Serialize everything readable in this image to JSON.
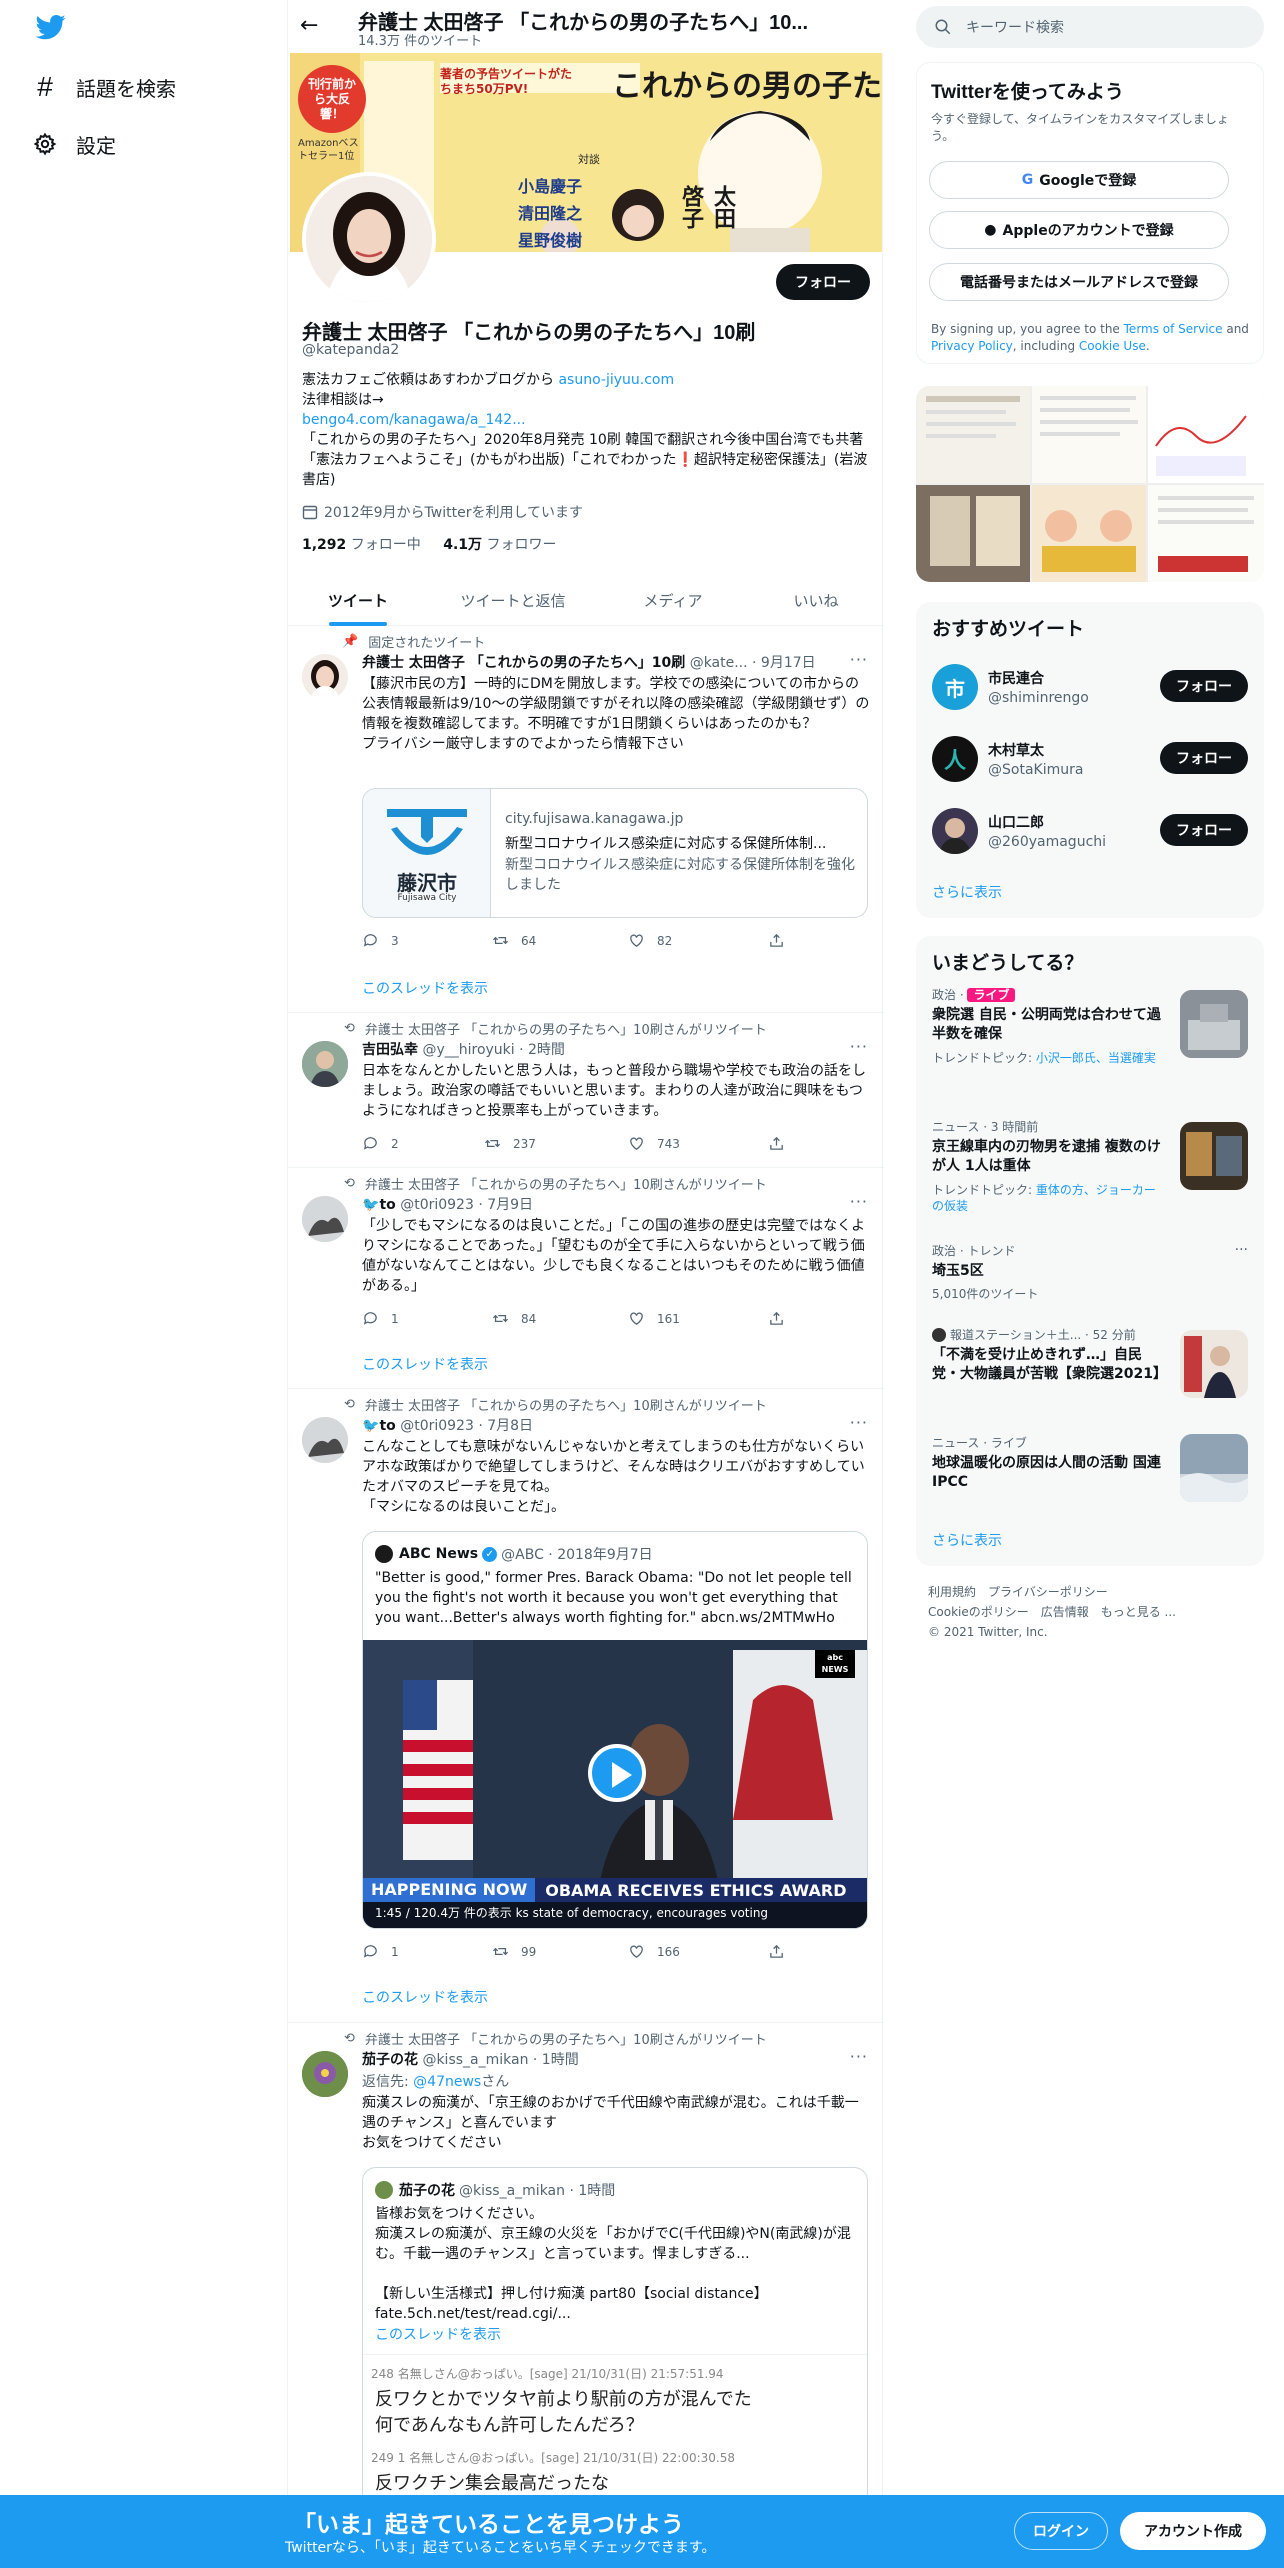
{
  "nav": {
    "search_label": "話題を検索",
    "settings_label": "設定"
  },
  "header": {
    "title": "弁護士 太田啓子 「これからの男の子たちへ」10...",
    "tweet_count": "14.3万 件のツイート"
  },
  "banner": {
    "top_label": "刊行前から大反響！",
    "top_sub": "Amazonベストセラー1位",
    "pv_label": "著者の予告ツイートがたちまち50万PV!",
    "big_title": "これからの男の子たちへ",
    "author": "太田啓子",
    "guests": [
      "小島慶子",
      "清田隆之",
      "星野俊樹"
    ],
    "taidan": "対談"
  },
  "profile": {
    "follow_label": "フォロー",
    "name": "弁護士 太田啓子 「これからの男の子たちへ」10刷",
    "handle": "@katepanda2",
    "bio_line1": "憲法カフェご依頼はあすわかブログから ",
    "bio_link1": "asuno-jiyuu.com",
    "bio_line2": "法律相談は→",
    "bio_link2": "bengo4.com/kanagawa/a_142...",
    "bio_line3": "「これからの男の子たちへ」2020年8月発売 10刷 韓国で翻訳され今後中国台湾でも共著「憲法カフェへようこそ」(かもがわ出版)「これでわかった❗超訳特定秘密保護法」(岩波書店)",
    "joined": "2012年9月からTwitterを利用しています",
    "following_count": "1,292",
    "following_label": " フォロー中",
    "followers_count": "4.1万",
    "followers_label": " フォロワー"
  },
  "tabs": [
    "ツイート",
    "ツイートと返信",
    "メディア",
    "いいね"
  ],
  "tweets": {
    "t1": {
      "pinned": "固定されたツイート",
      "name": "弁護士 太田啓子 「これからの男の子たちへ」10刷",
      "handle": "@kate... · 9月17日",
      "text": "【藤沢市民の方】一時的にDMを開放します。学校での感染についての市からの公表情報最新は9/10～の学級閉鎖ですがそれ以降の感染確認（学級閉鎖せず）の情報を複数確認してます。不明確ですが1日閉鎖くらいはあったのかも？\nプライバシー厳守しますのでよかったら情報下さい",
      "card_domain": "city.fujisawa.kanagawa.jp",
      "card_title": "新型コロナウイルス感染症に対応する保健所体制...",
      "card_desc": "新型コロナウイルス感染症に対応する保健所体制を強化しました",
      "card_city": "藤沢市",
      "card_city_en": "Fujisawa City",
      "replies": "3",
      "retweets": "64",
      "likes": "82",
      "thread": "このスレッドを表示"
    },
    "t2": {
      "rt": "弁護士 太田啓子 「これからの男の子たちへ」10刷さんがリツイート",
      "name": "吉田弘幸",
      "handle": "@y__hiroyuki · 2時間",
      "text": "日本をなんとかしたいと思う人は，もっと普段から職場や学校でも政治の話をしましょう。政治家の噂話でもいいと思います。まわりの人達が政治に興味をもつようになればきっと投票率も上がっていきます。",
      "replies": "2",
      "retweets": "237",
      "likes": "743"
    },
    "t3": {
      "rt": "弁護士 太田啓子 「これからの男の子たちへ」10刷さんがリツイート",
      "name": "to",
      "handle": "@t0ri0923 · 7月9日",
      "text": "「少しでもマシになるのは良いことだ。」「この国の進歩の歴史は完璧ではなくよりマシになることであった。」「望むものが全て手に入らないからといって戦う価値がないなんてことはない。少しでも良くなることはいつもそのために戦う価値がある。」",
      "replies": "1",
      "retweets": "84",
      "likes": "161",
      "thread": "このスレッドを表示"
    },
    "t4": {
      "rt": "弁護士 太田啓子 「これからの男の子たちへ」10刷さんがリツイート",
      "name": "to",
      "handle": "@t0ri0923 · 7月8日",
      "text": "こんなことしても意味がないんじゃないかと考えてしまうのも仕方がないくらいアホな政策ばかりで絶望してしまうけど、そんな時はクリエバがおすすめしていたオバマのスピーチを見てね。\n「マシになるのは良いことだ」。",
      "q_name": "ABC News",
      "q_handle": "@ABC · 2018年9月7日",
      "q_text": "\"Better is good,\" former Pres. Barack Obama: \"Do not let people tell you the fight's not worth it because you won't get everything that you want...Better's always worth fighting for.\" abcn.ws/2MTMwHo",
      "v_banner": "HAPPENING NOW",
      "v_title": "OBAMA RECEIVES ETHICS AWARD",
      "v_sub": "1:45 / 120.4万 件の表示 ks state of democracy, encourages voting",
      "v_logo": "abc NEWS",
      "replies": "1",
      "retweets": "99",
      "likes": "166",
      "thread": "このスレッドを表示"
    },
    "t5": {
      "rt": "弁護士 太田啓子 「これからの男の子たちへ」10刷さんがリツイート",
      "name": "茄子の花",
      "handle": "@kiss_a_mikan · 1時間",
      "reply_to_prefix": "返信先: ",
      "reply_to": "@47news",
      "reply_to_suffix": "さん",
      "text": "痴漢スレの痴漢が、「京王線のおかげで千代田線や南武線が混む。これは千載一遇のチャンス」と喜んでいます\nお気をつけてください",
      "q_name": "茄子の花",
      "q_handle": "@kiss_a_mikan · 1時間",
      "q_text": "皆様お気をつけください。\n痴漢スレの痴漢が、京王線の火災を「おかげでC(千代田線)やN(南武線)が混む。千載一遇のチャンス」と言っています。悍ましすぎる...\n\n【新しい生活様式】押し付け痴漢 part80【social distance】\nfate.5ch.net/test/read.cgi/...",
      "q_thread": "このスレッドを表示",
      "post1_head": "248  名無しさん@おっぱい。[sage] 21/10/31(日) 21:57:51.94",
      "post1_text": "反ワクとかでツタヤ前より駅前の方が混んでた\n何であんなもん許可したんだろ？",
      "post2_head": "249  1  名無しさん@おっぱい。[sage] 21/10/31(日) 22:00:30.58",
      "post2_text": "反ワクチン集会最高だったな"
    }
  },
  "right": {
    "search_placeholder": "キーワード検索",
    "signup": {
      "title": "Twitterを使ってみよう",
      "sub": "今すぐ登録して、タイムラインをカスタマイズしましょう。",
      "google": "Googleで登録",
      "apple": "Appleのアカウントで登録",
      "phone": "電話番号またはメールアドレスで登録",
      "terms_pre": "By signing up, you agree to the ",
      "terms": "Terms of Service",
      "and": " and ",
      "privacy": "Privacy Policy",
      "including": ", including ",
      "cookie": "Cookie Use",
      "end": "."
    },
    "recommend": {
      "title": "おすすめツイート",
      "users": [
        {
          "name": "市民連合",
          "handle": "@shiminrengo",
          "glyph": "市"
        },
        {
          "name": "木村草太",
          "handle": "@SotaKimura",
          "glyph": "人"
        },
        {
          "name": "山口二郎",
          "handle": "@260yamaguchi",
          "glyph": ""
        }
      ],
      "follow": "フォロー",
      "more": "さらに表示"
    },
    "trends": {
      "title": "いまどうしてる？",
      "items": [
        {
          "cat": "政治 · ",
          "live": "ライブ",
          "title": "衆院選 自民・公明両党は合わせて過半数を確保",
          "sub_pre": "トレンドトピック: ",
          "sub_link": "小沢一郎氏、当選確実"
        },
        {
          "cat": "ニュース · 3 時間前",
          "title": "京王線車内の刃物男を逮捕 複数のけが人 1人は重体",
          "sub_pre": "トレンドトピック: ",
          "sub_link": "重体の方、ジョーカーの仮装"
        },
        {
          "cat": "政治 · トレンド",
          "title": "埼玉5区",
          "sub_pre": "5,010件のツイート",
          "sub_link": ""
        },
        {
          "cat": "報道ステーション＋土... · 52 分前",
          "title": "「不満を受け止めきれず…」自民党・大物議員が苦戦【衆院選2021】"
        },
        {
          "cat": "ニュース · ライブ",
          "title": "地球温暖化の原因は人間の活動 国連IPCC"
        }
      ],
      "more": "さらに表示"
    },
    "footer": {
      "l1": "利用規約　プライバシーポリシー",
      "l2": "Cookieのポリシー　広告情報　もっと見る ...",
      "l3": "© 2021 Twitter, Inc."
    }
  },
  "bottom": {
    "title": "「いま」起きていることを見つけよう",
    "sub": "Twitterなら、「いま」起きていることをいち早くチェックできます。",
    "login": "ログイン",
    "signup": "アカウント作成"
  },
  "colors": {
    "accent": "#1d9bf0",
    "text": "#0f1419",
    "muted": "#536471",
    "live": "#f91880"
  }
}
